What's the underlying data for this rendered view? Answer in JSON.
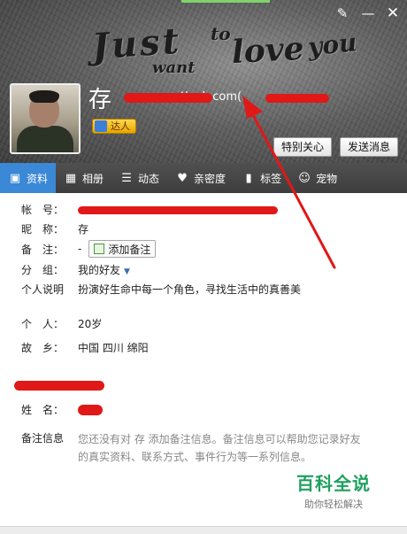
{
  "header": {
    "decor_words": [
      "Just",
      "to",
      "love",
      "you",
      "want"
    ],
    "nickname": "存",
    "email_visible": "tlook.com(",
    "badge_label": "达人",
    "follow_button": "特别关心",
    "message_button": "发送消息"
  },
  "window_buttons": {
    "brush": "✎",
    "minimize": "—",
    "close": "✕"
  },
  "tabs": [
    {
      "label": "资料",
      "icon": "profile-card-icon",
      "glyph": "▣"
    },
    {
      "label": "相册",
      "icon": "photo-album-icon",
      "glyph": "▦"
    },
    {
      "label": "动态",
      "icon": "feed-list-icon",
      "glyph": "☰"
    },
    {
      "label": "亲密度",
      "icon": "heart-icon",
      "glyph": "♥"
    },
    {
      "label": "标签",
      "icon": "bookmark-icon",
      "glyph": "▮"
    },
    {
      "label": "宠物",
      "icon": "pet-icon",
      "glyph": "☺"
    }
  ],
  "profile": {
    "account_label": "帐　号：",
    "nickname_label": "昵　称：",
    "nickname_value": "存",
    "remark_label": "备　注：",
    "remark_value": "-",
    "remark_button": "添加备注",
    "group_label": "分　组：",
    "group_value": "我的好友",
    "bio_label": "个人说明",
    "bio_value": "扮演好生命中每一个角色，寻找生活中的真善美",
    "personal_label": "个　人：",
    "personal_value": "20岁",
    "hometown_label": "故　乡：",
    "hometown_value": "中国 四川 绵阳",
    "name_label": "姓　名：",
    "note_label": "备注信息",
    "note_value": "您还没有对 存 添加备注信息。备注信息可以帮助您记录好友的真实资料、联系方式、事件行为等一系列信息。"
  },
  "watermark": {
    "title": "百科全说",
    "subtitle": "助你轻松解决"
  },
  "colors": {
    "tab_active": "#3a88d6",
    "annotation_red": "#e01818",
    "watermark_green": "#20a060"
  }
}
